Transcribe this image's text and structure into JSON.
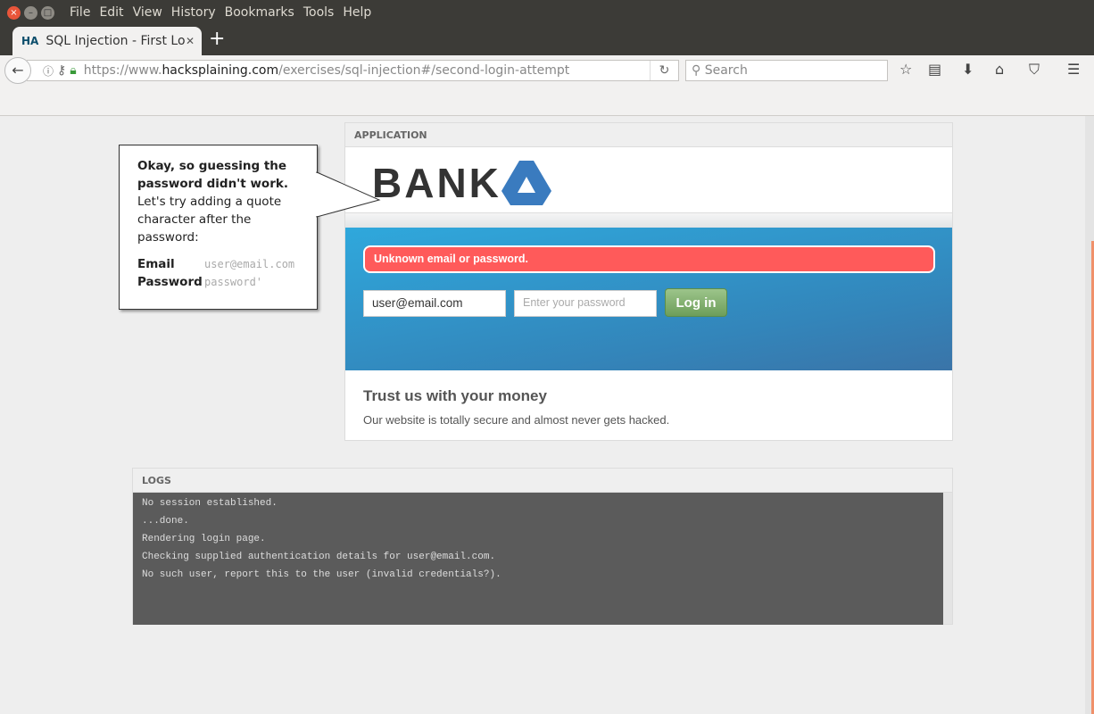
{
  "browser": {
    "menu": [
      "File",
      "Edit",
      "View",
      "History",
      "Bookmarks",
      "Tools",
      "Help"
    ],
    "tab": {
      "favicon": "HA",
      "title": "SQL Injection - First Lo"
    },
    "url": {
      "scheme": "https://www.",
      "domain": "hacksplaining.com",
      "path": "/exercises/sql-injection#/second-login-attempt"
    },
    "search_placeholder": "Search"
  },
  "callout": {
    "bold": "Okay, so guessing the password didn't work.",
    "text": " Let's try adding a quote character after the password:",
    "email_label": "Email",
    "email_value": "user@email.com",
    "password_label": "Password",
    "password_value": "password'"
  },
  "application": {
    "header": "APPLICATION",
    "logo_text": "BANK",
    "error": "Unknown email or password.",
    "email_value": "user@email.com",
    "password_placeholder": "Enter your password",
    "login_label": "Log in",
    "tagline": "Trust us with your money",
    "description": "Our website is totally secure and almost never gets hacked.",
    "brand_color": "#3a7bbf",
    "error_color": "#ff5a5a"
  },
  "logs": {
    "header": "LOGS",
    "lines": [
      "No session established.",
      "...done.",
      "Rendering login page.",
      "Checking supplied authentication details for user@email.com.",
      "No such user, report this to the user (invalid credentials?)."
    ]
  }
}
